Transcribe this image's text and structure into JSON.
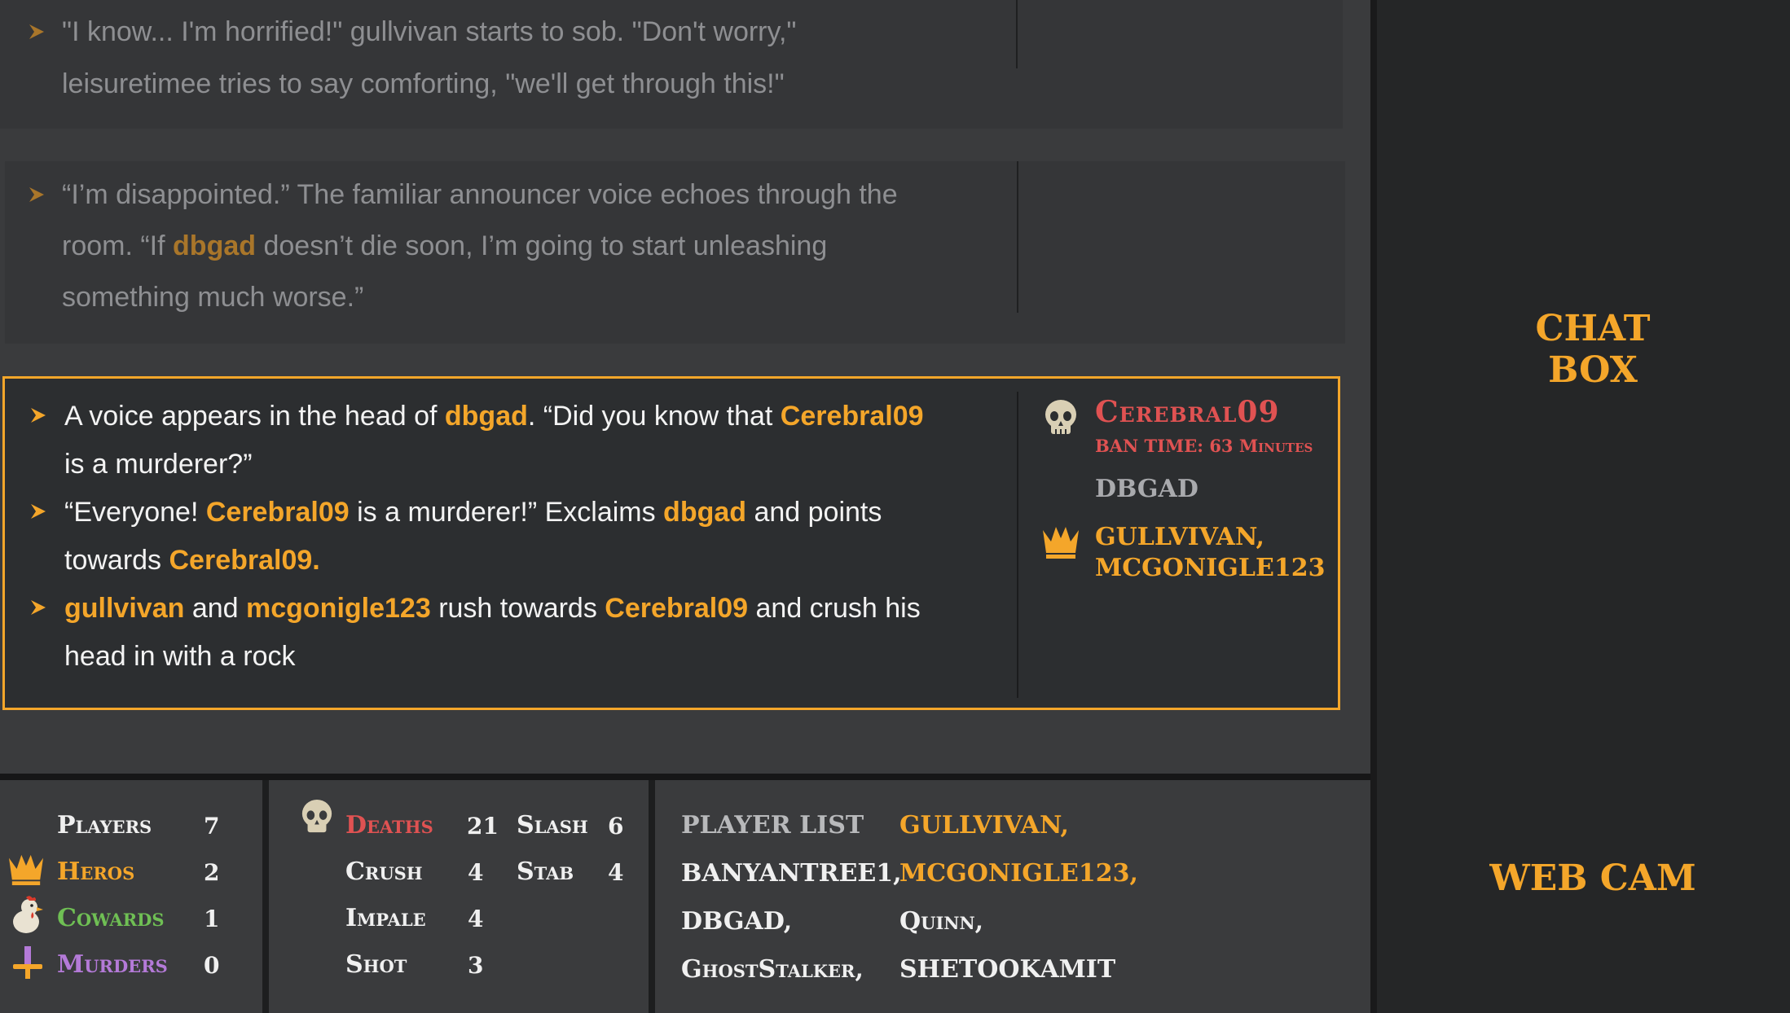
{
  "labels": {
    "chat_box_line1": "CHAT",
    "chat_box_line2": "BOX",
    "web_cam": "WEB CAM"
  },
  "events": [
    {
      "lines": [
        "\"I know... I'm horrified!\" gullvivan starts to sob. \"Don't worry,\"",
        "leisuretimee tries to say comforting, \"we'll get through this!\""
      ]
    },
    {
      "line1": "“I’m disappointed.” The familiar announcer voice echoes through the",
      "line2_pre": "room. “If ",
      "line2_name": "dbgad",
      "line2_post": " doesn’t die soon, I’m going to start unleashing",
      "line3": "something much worse.”"
    },
    {
      "a_pre": "A voice appears in the head of ",
      "a_n1": "dbgad",
      "a_mid": ". “Did you know that ",
      "a_n2": "Cerebral09",
      "a_end": "is a murderer?”",
      "b_pre": "“Everyone! ",
      "b_n1": "Cerebral09",
      "b_mid1": " is a murderer!” Exclaims ",
      "b_n2": "dbgad",
      "b_mid2": " and points",
      "b_end_pre": "towards ",
      "b_n3": "Cerebral09.",
      "c_n1": "gullvivan",
      "c_and": " and ",
      "c_n2": "mcgonigle123",
      "c_mid": " rush towards ",
      "c_n3": "Cerebral09",
      "c_post": " and crush his",
      "c_end": "head in with a rock",
      "side": {
        "dead_name": "Cerebral09",
        "ban_time": "BAN TIME: 63 Minutes",
        "neutral_name": "DBGAD",
        "hero_line1": "GULLVIVAN,",
        "hero_line2": "MCGONIGLE123"
      }
    }
  ],
  "stats": {
    "players_label": "Players",
    "players": "7",
    "heros_label": "Heros",
    "heros": "2",
    "cowards_label": "Cowards",
    "cowards": "1",
    "murders_label": "Murders",
    "murders": "0",
    "deaths_label": "Deaths",
    "deaths": "21",
    "slash_label": "Slash",
    "slash": "6",
    "crush_label": "Crush",
    "crush": "4",
    "stab_label": "Stab",
    "stab": "4",
    "impale_label": "Impale",
    "impale": "4",
    "shot_label": "Shot",
    "shot": "3",
    "player_list_label": "PLAYER LIST",
    "players_col1": [
      "BANYANTREE1,",
      "DBGAD,",
      "GhostStalker,"
    ],
    "players_col2": [
      "GULLVIVAN,",
      "MCGONIGLE123,",
      "Quinn,",
      "SHETOOKAMIT"
    ]
  },
  "colors": {
    "accent": "#f4a62a",
    "dead": "#e05252",
    "coward": "#6fbf54",
    "murder": "#b47ad8"
  },
  "icons": [
    "arrow-bullet-icon",
    "skull-icon",
    "crown-icon",
    "chicken-icon",
    "dagger-icon"
  ]
}
